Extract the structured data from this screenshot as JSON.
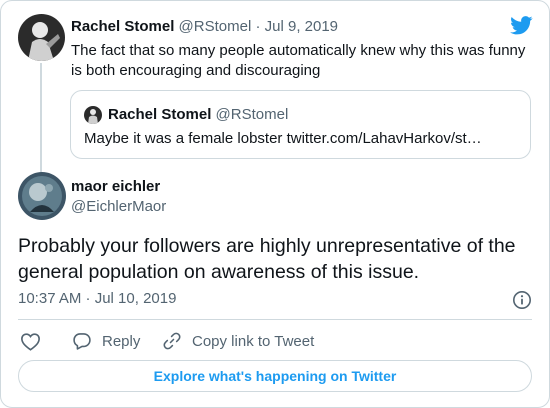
{
  "parent_tweet": {
    "display_name": "Rachel Stomel",
    "handle": "@RStomel",
    "separator": "·",
    "date": "Jul 9, 2019",
    "text": "The fact that so many people automatically knew why this was funny is both encouraging and discouraging",
    "quoted_tweet": {
      "display_name": "Rachel Stomel",
      "handle": "@RStomel",
      "text": "Maybe it was a female lobster twitter.com/LahavHarkov/st…"
    }
  },
  "main_tweet": {
    "display_name": "maor eichler",
    "handle": "@EichlerMaor",
    "text": "Probably your followers are highly unrepresentative of the general population on awareness of this issue.",
    "timestamp": "10:37 AM · Jul 10, 2019"
  },
  "actions": {
    "reply_label": "Reply",
    "copy_link_label": "Copy link to Tweet"
  },
  "explore_label": "Explore what's happening on Twitter",
  "colors": {
    "twitter_blue": "#1d9bf0",
    "text_primary": "#0f1419",
    "text_secondary": "#536471",
    "border": "#cfd9de"
  },
  "icons": {
    "brand": "twitter-bird-icon",
    "like": "heart-icon",
    "reply": "speech-bubble-icon",
    "copy": "link-icon",
    "info": "info-icon"
  }
}
